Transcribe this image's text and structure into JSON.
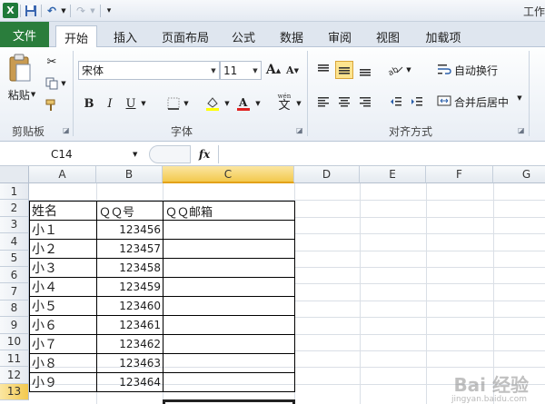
{
  "app": {
    "title": "工作",
    "logo_letter": "X"
  },
  "qat": {
    "save_icon": "💾",
    "undo_icon": "↶",
    "redo_icon": "↷",
    "customize_icon": "▾"
  },
  "tabs": [
    {
      "label": "文件"
    },
    {
      "label": "开始"
    },
    {
      "label": "插入"
    },
    {
      "label": "页面布局"
    },
    {
      "label": "公式"
    },
    {
      "label": "数据"
    },
    {
      "label": "审阅"
    },
    {
      "label": "视图"
    },
    {
      "label": "加载项"
    }
  ],
  "ribbon": {
    "clipboard": {
      "paste_label": "粘贴",
      "group_label": "剪贴板"
    },
    "font": {
      "font_name": "宋体",
      "font_size": "11",
      "grow_label": "A",
      "shrink_label": "A",
      "bold_label": "B",
      "italic_label": "I",
      "underline_label": "U",
      "phonetic_label": "wén",
      "phonetic_char": "文",
      "group_label": "字体",
      "fill_color": "#ffff00",
      "font_color": "#e02020"
    },
    "alignment": {
      "wrap_label": "自动换行",
      "merge_label": "合并后居中",
      "group_label": "对齐方式"
    }
  },
  "formula_bar": {
    "name_box": "C14",
    "fx_label": "fx",
    "formula": ""
  },
  "sheet": {
    "columns": [
      "A",
      "B",
      "C",
      "D",
      "E",
      "F",
      "G"
    ],
    "selected_column": "C",
    "rows": [
      "1",
      "2",
      "3",
      "4",
      "5",
      "6",
      "7",
      "8",
      "9",
      "10",
      "11",
      "12",
      "13"
    ],
    "header": [
      "姓名",
      "ＱＱ号",
      "ＱＱ邮箱"
    ],
    "data": [
      {
        "name": "小１",
        "qq": "123456",
        "email": ""
      },
      {
        "name": "小２",
        "qq": "123457",
        "email": ""
      },
      {
        "name": "小３",
        "qq": "123458",
        "email": ""
      },
      {
        "name": "小４",
        "qq": "123459",
        "email": ""
      },
      {
        "name": "小５",
        "qq": "123460",
        "email": ""
      },
      {
        "name": "小６",
        "qq": "123461",
        "email": ""
      },
      {
        "name": "小７",
        "qq": "123462",
        "email": ""
      },
      {
        "name": "小８",
        "qq": "123463",
        "email": ""
      },
      {
        "name": "小９",
        "qq": "123464",
        "email": ""
      }
    ]
  },
  "watermark": {
    "main": "Bai 经验",
    "sub": "jingyan.baidu.com"
  },
  "colors": {
    "file_tab": "#2a7d3c",
    "selected_header": "#f3c94e",
    "selected_align": "#fde48f"
  }
}
